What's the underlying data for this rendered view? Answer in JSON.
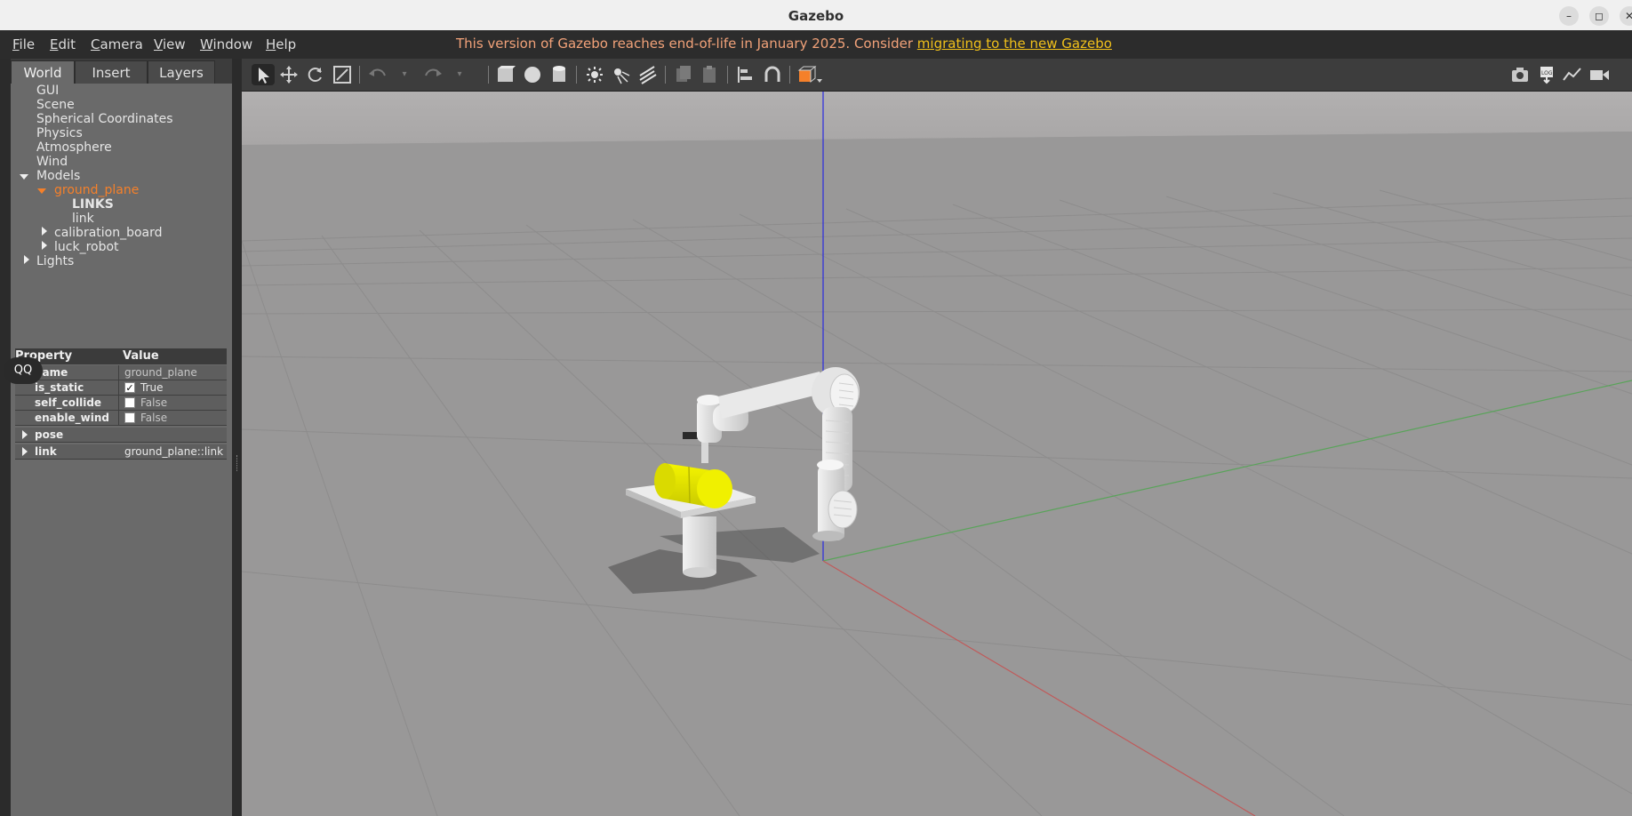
{
  "window": {
    "title": "Gazebo",
    "controls": [
      "–",
      "◻",
      "✕"
    ]
  },
  "menu": {
    "items": [
      "File",
      "Edit",
      "Camera",
      "View",
      "Window",
      "Help"
    ]
  },
  "notice": {
    "text": "This version of Gazebo reaches end-of-life in January 2025. Consider ",
    "link": "migrating to the new Gazebo"
  },
  "tabs": [
    "World",
    "Insert",
    "Layers"
  ],
  "tree": {
    "gui": "GUI",
    "scene": "Scene",
    "spherical": "Spherical Coordinates",
    "physics": "Physics",
    "atmosphere": "Atmosphere",
    "wind": "Wind",
    "models": "Models",
    "ground_plane": "ground_plane",
    "links": "LINKS",
    "link": "link",
    "calibration_board": "calibration_board",
    "luck_robot": "luck_robot",
    "lights": "Lights"
  },
  "properties": {
    "header_property": "Property",
    "header_value": "Value",
    "rows": [
      {
        "name": "name",
        "value": "ground_plane"
      },
      {
        "name": "is_static",
        "value": "True",
        "checked": true
      },
      {
        "name": "self_collide",
        "value": "False",
        "checked": false
      },
      {
        "name": "enable_wind",
        "value": "False",
        "checked": false
      },
      {
        "name": "pose",
        "value": ""
      },
      {
        "name": "link",
        "value": "ground_plane::link"
      }
    ]
  },
  "overlay": {
    "qq": "QQ"
  },
  "colors": {
    "selected_model": "#f5802a",
    "notice": "#f2a279",
    "link": "#f0c01a",
    "target_object": "#e8e800"
  }
}
